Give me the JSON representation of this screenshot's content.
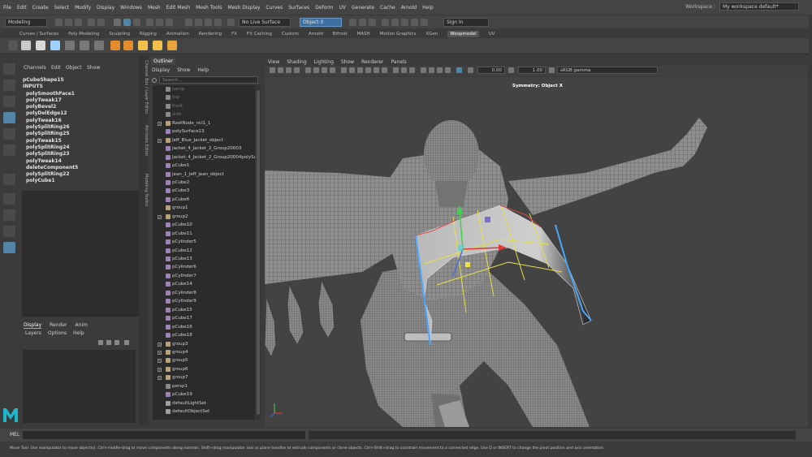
{
  "menubar": {
    "items": [
      "File",
      "Edit",
      "Create",
      "Select",
      "Modify",
      "Display",
      "Windows",
      "Mesh",
      "Edit Mesh",
      "Mesh Tools",
      "Mesh Display",
      "Curves",
      "Surfaces",
      "Deform",
      "UV",
      "Generate",
      "Cache",
      "Arnold",
      "Help"
    ],
    "workspace_label": "Workspace :",
    "workspace_value": "My workspace default*"
  },
  "statusline": {
    "mode": "Modeling",
    "live_surface": "No Live Surface",
    "object_field": "Object 0",
    "sign_in": "Sign In"
  },
  "shelf": {
    "tabs": [
      "Curves / Surfaces",
      "Poly Modeling",
      "Sculpting",
      "Rigging",
      "Animation",
      "Rendering",
      "FX",
      "FX Caching",
      "Custom",
      "Arnold",
      "Bifrost",
      "MASH",
      "Motion Graphics",
      "XGen",
      "Woopmodel",
      "UV"
    ],
    "active_tab": "Woopmodel"
  },
  "channelbox": {
    "menus": [
      "Channels",
      "Edit",
      "Object",
      "Show"
    ],
    "items": [
      "pCubeShape15",
      "INPUTS",
      "polySmoothFace1",
      "polyTweak17",
      "polyBevel2",
      "polyDelEdge12",
      "polyTweak16",
      "polySplitRing26",
      "polySplitRing25",
      "polyTweak15",
      "polySplitRing24",
      "polySplitRing23",
      "polyTweak14",
      "deleteComponent5",
      "polySplitRing22",
      "polyCube1"
    ]
  },
  "layereditor": {
    "tabs": [
      "Display",
      "Render",
      "Anim"
    ],
    "menus": [
      "Layers",
      "Options",
      "Help"
    ]
  },
  "side_tabs": [
    "Channel Box / Layer Editor",
    "Attribute Editor",
    "Modeling Toolkit"
  ],
  "outliner": {
    "title": "Outliner",
    "menus": [
      "Display",
      "Show",
      "Help"
    ],
    "search_placeholder": "Search...",
    "rows": [
      {
        "label": "persp",
        "type": "camera",
        "dim": true,
        "exp": false
      },
      {
        "label": "top",
        "type": "camera",
        "dim": true,
        "exp": false
      },
      {
        "label": "front",
        "type": "camera",
        "dim": true,
        "exp": false
      },
      {
        "label": "side",
        "type": "camera",
        "dim": true,
        "exp": false
      },
      {
        "label": "RootNode_ncl1_1",
        "type": "group",
        "dim": false,
        "exp": true
      },
      {
        "label": "polySurface13",
        "type": "mesh",
        "dim": false,
        "exp": false
      },
      {
        "label": "Jeff_Blue_Jacket_object",
        "type": "group",
        "dim": false,
        "exp": true
      },
      {
        "label": "Jacket_4_Jacket_2_Group20003",
        "type": "mesh",
        "dim": false,
        "exp": false
      },
      {
        "label": "Jacket_4_Jacket_2_Group20004polySur",
        "type": "mesh",
        "dim": false,
        "exp": false
      },
      {
        "label": "pCube1",
        "type": "mesh",
        "dim": false,
        "exp": false
      },
      {
        "label": "jean_1_Jeff_jean_object",
        "type": "mesh",
        "dim": false,
        "exp": false
      },
      {
        "label": "pCube2",
        "type": "mesh",
        "dim": false,
        "exp": false
      },
      {
        "label": "pCube3",
        "type": "mesh",
        "dim": false,
        "exp": false
      },
      {
        "label": "pCube6",
        "type": "mesh",
        "dim": false,
        "exp": false
      },
      {
        "label": "group1",
        "type": "group",
        "dim": false,
        "exp": false
      },
      {
        "label": "group2",
        "type": "group",
        "dim": false,
        "exp": true
      },
      {
        "label": "pCube10",
        "type": "mesh",
        "dim": false,
        "exp": false
      },
      {
        "label": "pCube11",
        "type": "mesh",
        "dim": false,
        "exp": false
      },
      {
        "label": "pCylinder5",
        "type": "mesh",
        "dim": false,
        "exp": false
      },
      {
        "label": "pCube12",
        "type": "mesh",
        "dim": false,
        "exp": false
      },
      {
        "label": "pCube13",
        "type": "mesh",
        "dim": false,
        "exp": false
      },
      {
        "label": "pCylinder6",
        "type": "mesh",
        "dim": false,
        "exp": false
      },
      {
        "label": "pCylinder7",
        "type": "mesh",
        "dim": false,
        "exp": false
      },
      {
        "label": "pCube14",
        "type": "mesh",
        "dim": false,
        "exp": false
      },
      {
        "label": "pCylinder8",
        "type": "mesh",
        "dim": false,
        "exp": false
      },
      {
        "label": "pCylinder9",
        "type": "mesh",
        "dim": false,
        "exp": false
      },
      {
        "label": "pCube15",
        "type": "mesh",
        "dim": false,
        "exp": false
      },
      {
        "label": "pCube17",
        "type": "mesh",
        "dim": false,
        "exp": false
      },
      {
        "label": "pCube16",
        "type": "mesh",
        "dim": false,
        "exp": false
      },
      {
        "label": "pCube18",
        "type": "mesh",
        "dim": false,
        "exp": false
      },
      {
        "label": "group3",
        "type": "group",
        "dim": false,
        "exp": true
      },
      {
        "label": "group4",
        "type": "group",
        "dim": false,
        "exp": true
      },
      {
        "label": "group5",
        "type": "group",
        "dim": false,
        "exp": true
      },
      {
        "label": "group6",
        "type": "group",
        "dim": false,
        "exp": true
      },
      {
        "label": "group7",
        "type": "group",
        "dim": false,
        "exp": true
      },
      {
        "label": "persp1",
        "type": "camera",
        "dim": false,
        "exp": false
      },
      {
        "label": "pCube19",
        "type": "mesh",
        "dim": false,
        "exp": false
      },
      {
        "label": "defaultLightSet",
        "type": "set",
        "dim": false,
        "exp": false
      },
      {
        "label": "defaultObjectSet",
        "type": "set",
        "dim": false,
        "exp": false
      }
    ]
  },
  "viewport": {
    "menus": [
      "View",
      "Shading",
      "Lighting",
      "Show",
      "Renderer",
      "Panels"
    ],
    "field1": "0.00",
    "field2": "1.00",
    "colorspace": "sRGB gamma",
    "symmetry_label": "Symmetry: Object X"
  },
  "mel": {
    "label": "MEL"
  },
  "help_line": "Move Tool: Use manipulator to move object(s). Ctrl+middle-drag to move components along normals. Shift+drag manipulator axis or plane handles to extrude components or clone objects. Ctrl+Shift+drag to constrain movement to a connected edge. Use D or INSERT to change the pivot position and axis orientation.",
  "colors": {
    "accent": "#5285a6",
    "selected_field": "#3d6fa0",
    "maya_logo": "#1fb5c9",
    "outliner_group": "#b7a37a",
    "outliner_mesh": "#9b84b6",
    "outliner_camera": "#8a8a8a",
    "outliner_set": "#a0a0a0"
  }
}
